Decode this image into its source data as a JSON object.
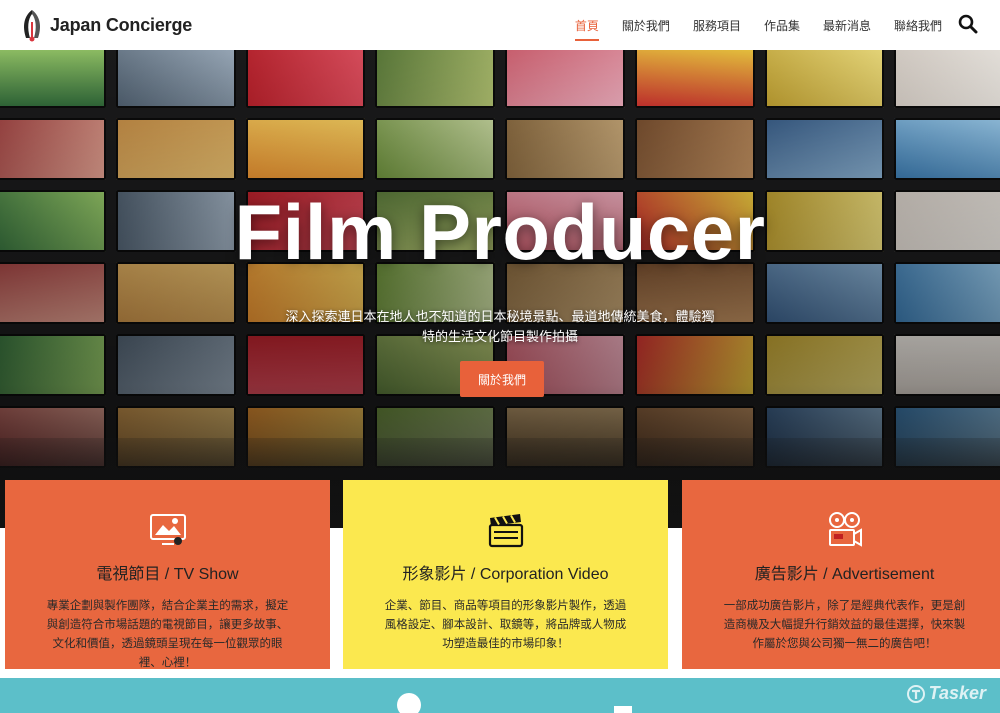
{
  "header": {
    "logo_text": "Japan Concierge",
    "nav": [
      {
        "label": "首頁",
        "active": true
      },
      {
        "label": "關於我們"
      },
      {
        "label": "服務項目"
      },
      {
        "label": "作品集"
      },
      {
        "label": "最新消息"
      },
      {
        "label": "聯絡我們"
      }
    ],
    "search_icon": "search-icon"
  },
  "hero": {
    "title": "Film Producer",
    "subtitle": "深入探索連日本在地人也不知道的日本秘境景點、最道地傳統美食，體驗獨特的生活文化節目製作拍攝",
    "button_label": "關於我們"
  },
  "services": [
    {
      "icon": "tv-show-icon",
      "title": "電視節目 / TV Show",
      "desc": "專業企劃與製作團隊，結合企業主的需求，擬定與創造符合市場話題的電視節目，讓更多故事、文化和價值，透過鏡頭呈現在每一位觀眾的眼裡、心裡！",
      "color": "#e8673f"
    },
    {
      "icon": "clapperboard-icon",
      "title": "形象影片 / Corporation Video",
      "desc": "企業、節目、商品等項目的形象影片製作，透過風格設定、腳本設計、取鏡等，將品牌或人物成功塑造最佳的市場印象！",
      "color": "#fbe84f"
    },
    {
      "icon": "film-camera-icon",
      "title": "廣告影片 / Advertisement",
      "desc": "一部成功廣告影片，除了是經典代表作，更是創造商機及大幅提升行銷效益的最佳選擇，快來製作屬於您與公司獨一無二的廣告吧！",
      "color": "#e8673f"
    }
  ],
  "watermark": "Tasker",
  "colors": {
    "accent": "#e8613a",
    "teal": "#5cbfc9",
    "yellow": "#fbe84f"
  }
}
